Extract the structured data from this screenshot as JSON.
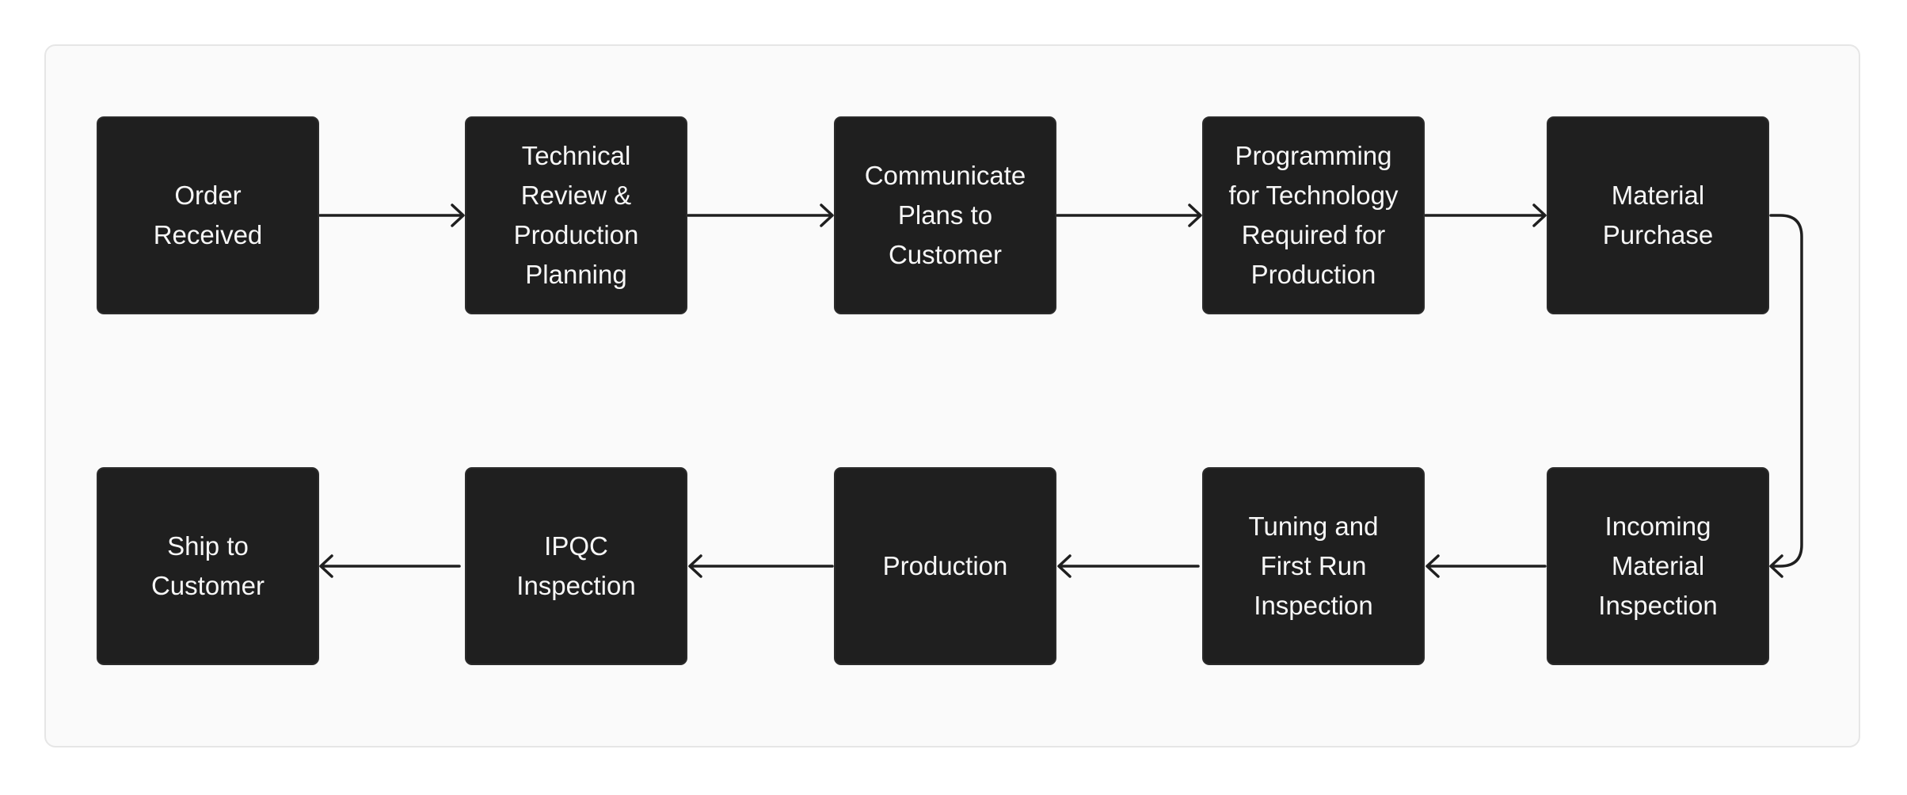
{
  "diagram": {
    "title": "",
    "colors": {
      "node_fill": "#1f1f1f",
      "node_text": "#f7f7f7",
      "canvas_fill": "#fafafa",
      "connector": "#1f1f1f"
    },
    "nodes": [
      {
        "id": "n1",
        "label": "Order\nReceived"
      },
      {
        "id": "n2",
        "label": "Technical\nReview &\nProduction\nPlanning"
      },
      {
        "id": "n3",
        "label": "Communicate\nPlans to\nCustomer"
      },
      {
        "id": "n4",
        "label": "Programming\nfor Technology\nRequired for\nProduction"
      },
      {
        "id": "n5",
        "label": "Material\nPurchase"
      },
      {
        "id": "n6",
        "label": "Incoming\nMaterial\nInspection"
      },
      {
        "id": "n7",
        "label": "Tuning and\nFirst Run\nInspection"
      },
      {
        "id": "n8",
        "label": "Production"
      },
      {
        "id": "n9",
        "label": "IPQC\nInspection"
      },
      {
        "id": "n10",
        "label": "Ship to\nCustomer"
      }
    ],
    "edges": [
      {
        "from": "n1",
        "to": "n2"
      },
      {
        "from": "n2",
        "to": "n3"
      },
      {
        "from": "n3",
        "to": "n4"
      },
      {
        "from": "n4",
        "to": "n5"
      },
      {
        "from": "n5",
        "to": "n6"
      },
      {
        "from": "n6",
        "to": "n7"
      },
      {
        "from": "n7",
        "to": "n8"
      },
      {
        "from": "n8",
        "to": "n9"
      },
      {
        "from": "n9",
        "to": "n10"
      }
    ]
  }
}
